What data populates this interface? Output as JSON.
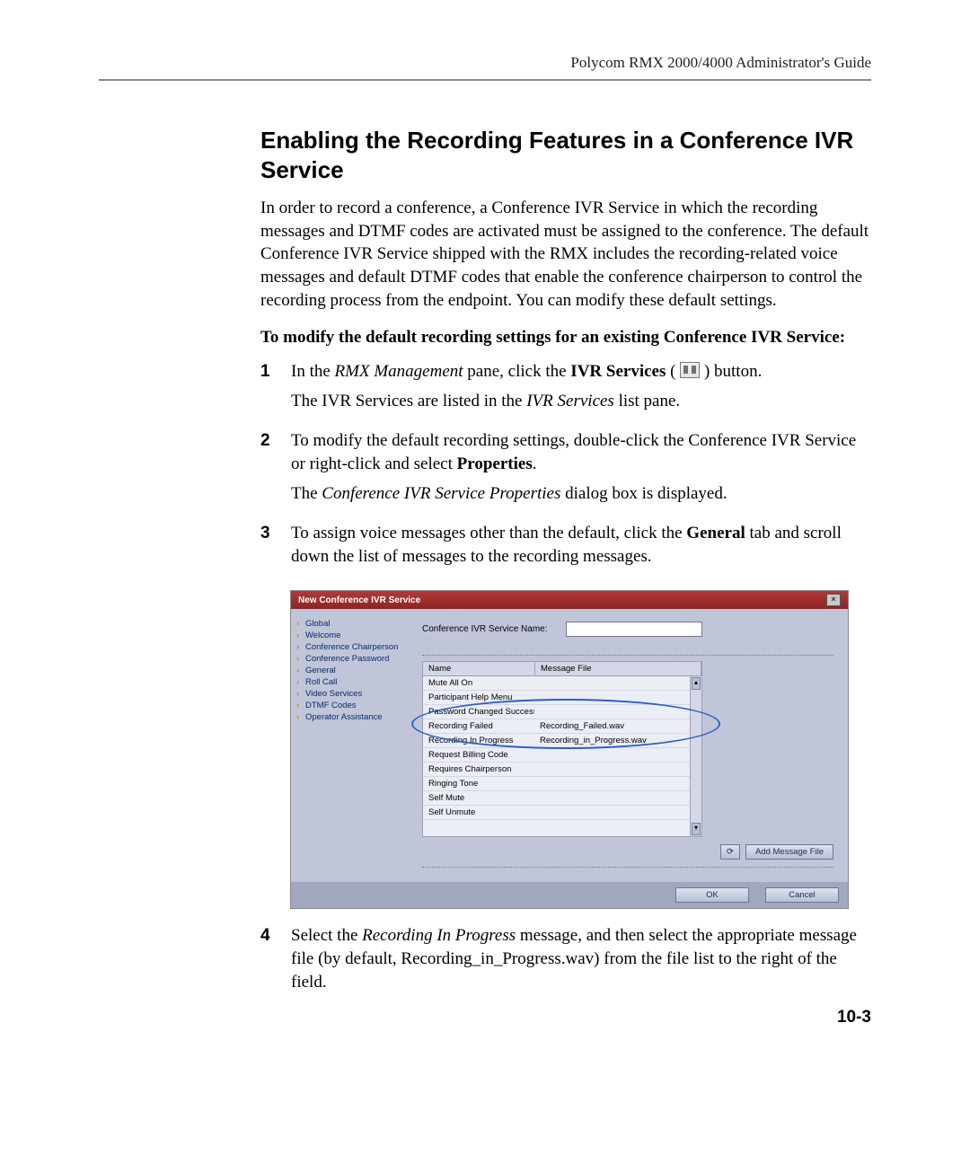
{
  "running_head": "Polycom RMX 2000/4000 Administrator's Guide",
  "section_title": "Enabling the Recording Features in a Conference IVR Service",
  "intro": "In order to record a conference, a Conference IVR Service in which the recording messages and DTMF codes are activated must be assigned to the conference. The default Conference IVR Service shipped with the RMX includes the recording-related voice messages and default DTMF codes that enable the conference chairperson to control the recording process from the endpoint. You can modify these default settings.",
  "subhead": "To modify the default recording settings for an existing Conference IVR Service:",
  "steps": {
    "s1a_pre": "In the ",
    "s1a_em": "RMX Management",
    "s1a_mid": " pane, click the ",
    "s1a_b": "IVR Services",
    "s1a_post": " ( ",
    "s1a_tail": " ) button.",
    "s1b_pre": "The IVR Services are listed in the ",
    "s1b_em": "IVR Services",
    "s1b_post": " list pane.",
    "s2a": "To modify the default recording settings, double-click the Conference IVR Service or right-click and select ",
    "s2a_b": "Properties",
    "s2a_post": ".",
    "s2b_pre": "The ",
    "s2b_em": "Conference IVR Service Properties",
    "s2b_post": " dialog box is displayed.",
    "s3_pre": "To assign voice messages other than the default, click the ",
    "s3_b": "General",
    "s3_post": " tab and scroll down the list of messages to the recording messages.",
    "s4_pre": "Select the ",
    "s4_em": "Recording In Progress",
    "s4_post": " message, and then select the appropriate message file (by default, Recording_in_Progress.wav) from the file list to the right of the field."
  },
  "dialog": {
    "title": "New Conference IVR Service",
    "close_glyph": "×",
    "nav": [
      "Global",
      "Welcome",
      "Conference Chairperson",
      "Conference Password",
      "General",
      "Roll Call",
      "Video Services",
      "DTMF Codes",
      "Operator Assistance"
    ],
    "field_label": "Conference IVR Service Name:",
    "table": {
      "col1": "Name",
      "col2": "Message File",
      "rows": [
        {
          "name": "Mute All On",
          "file": ""
        },
        {
          "name": "Participant Help Menu",
          "file": ""
        },
        {
          "name": "Password Changed Successfu",
          "file": ""
        },
        {
          "name": "Recording Failed",
          "file": "Recording_Failed.wav"
        },
        {
          "name": "Recording In Progress",
          "file": "Recording_in_Progress.wav"
        },
        {
          "name": "Request Billing Code",
          "file": ""
        },
        {
          "name": "Requires Chairperson",
          "file": ""
        },
        {
          "name": "Ringing Tone",
          "file": ""
        },
        {
          "name": "Self Mute",
          "file": ""
        },
        {
          "name": "Self Unmute",
          "file": ""
        }
      ]
    },
    "add_btn": "Add Message File",
    "ok": "OK",
    "cancel": "Cancel",
    "scroll_up": "▴",
    "scroll_down": "▾"
  },
  "page_number": "10-3"
}
